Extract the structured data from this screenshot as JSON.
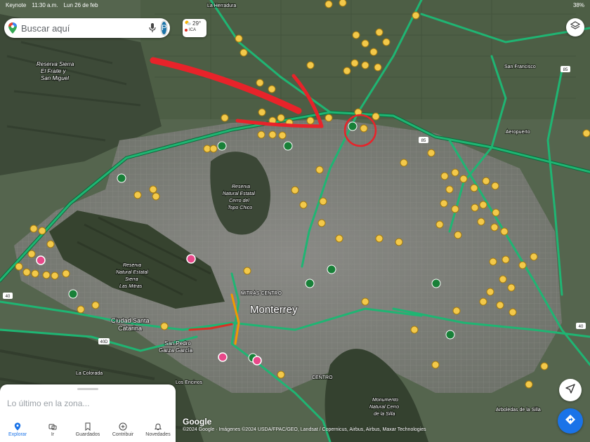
{
  "status_bar": {
    "carrier": "Keynote",
    "time": "11:30 a.m.",
    "date": "Lun 26 de feb",
    "battery": "38%"
  },
  "search": {
    "placeholder": "Buscar aquí",
    "avatar_letter": "P"
  },
  "weather": {
    "temperature": "29°",
    "air_quality": "ICA"
  },
  "map_labels": {
    "monterrey": "Monterrey",
    "reserva_fraile_1": "Reserva Sierra",
    "reserva_fraile_2": "El Fraile y",
    "reserva_fraile_3": "San Miguel",
    "reserva_topo_1": "Reserva",
    "reserva_topo_2": "Natural Estatal",
    "reserva_topo_3": "Cerro del",
    "reserva_topo_4": "Topo Chico",
    "reserva_mitras_1": "Reserva",
    "reserva_mitras_2": "Natural Estatal",
    "reserva_mitras_3": "Sierra",
    "reserva_mitras_4": "Las Mitras",
    "santa_catarina_1": "Ciudad Santa",
    "santa_catarina_2": "Catarina",
    "san_pedro_1": "San Pedro",
    "san_pedro_2": "Garza García",
    "cerro_silla_1": "Monumento",
    "cerro_silla_2": "Natural Cerro",
    "cerro_silla_3": "de la Silla",
    "mitras_centro": "MITRAS CENTRO",
    "la_herradura": "La Herradura",
    "aeropuerto": "Aeropuerto",
    "san_francisco": "San Francisco",
    "los_encinos": "Los Encinos",
    "la_colorada": "La Colorada",
    "arboledas": "Arboledas de la Silla",
    "centro": "CENTRO"
  },
  "highway_shields": [
    "85",
    "40D",
    "40",
    "85",
    "40"
  ],
  "attribution": {
    "logo": "Google",
    "text": "©2024 Google · Imágenes ©2024 USDA/FPAC/GEO, Landsat / Copernicus, Airbus, Airbus, Maxar Technologies"
  },
  "bottom_sheet": {
    "nearby_label": "Lo último en la zona..."
  },
  "nav": [
    {
      "label": "Explorar"
    },
    {
      "label": "Ir"
    },
    {
      "label": "Guardados"
    },
    {
      "label": "Contribuir"
    },
    {
      "label": "Novedades"
    }
  ],
  "colors": {
    "traffic_green": "#1fb573",
    "traffic_orange": "#f29900",
    "traffic_red": "#d93025",
    "poi_yellow": "#f3c94a",
    "annotation_red": "#e8232a",
    "accent_blue": "#1a73e8"
  },
  "icons": {
    "search_logo": "maps-pin-icon",
    "mic": "mic-icon",
    "layers": "layers-icon",
    "compass": "navigation-arrow-icon",
    "directions": "directions-icon"
  }
}
